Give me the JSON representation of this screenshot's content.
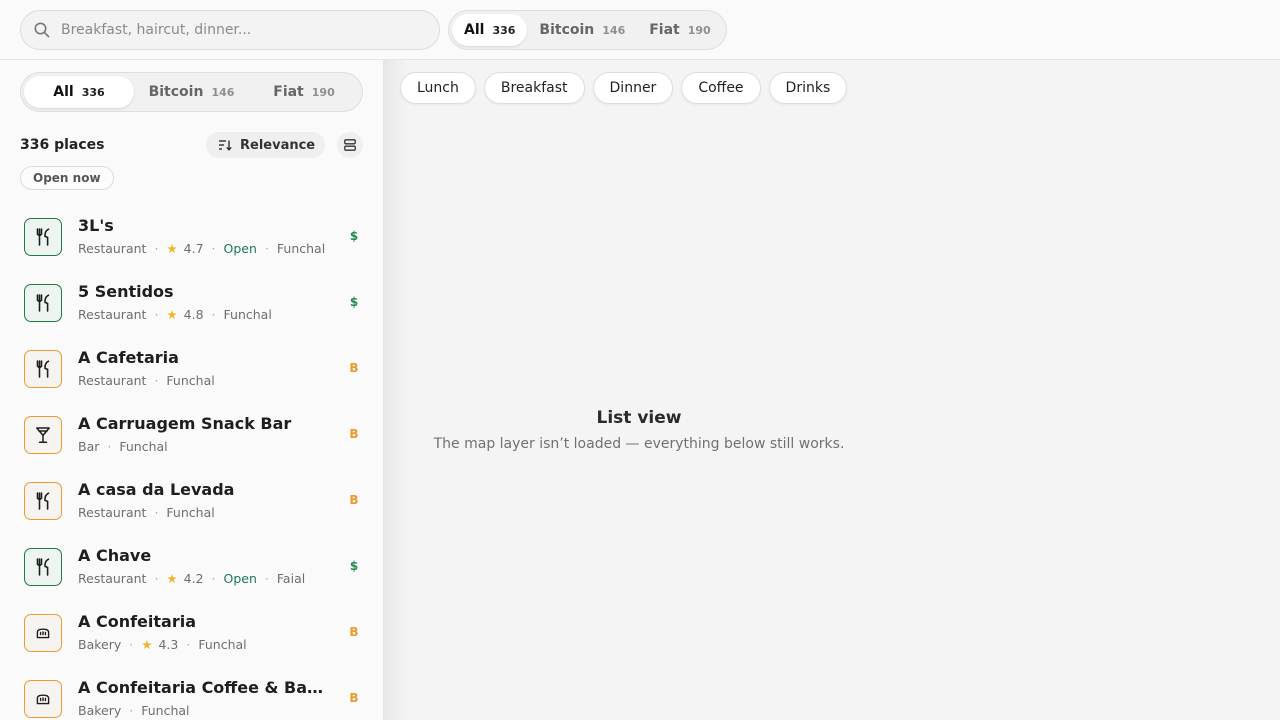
{
  "search": {
    "placeholder": "Breakfast, haircut, dinner..."
  },
  "payment_filter": [
    {
      "label": "All",
      "count": "336",
      "active": true
    },
    {
      "label": "Bitcoin",
      "count": "146",
      "active": false
    },
    {
      "label": "Fiat",
      "count": "190",
      "active": false
    }
  ],
  "sidebar": {
    "count_label": "336 places",
    "sort_label": "Relevance",
    "open_now_label": "Open now",
    "places": [
      {
        "name": "3L's",
        "category": "Restaurant",
        "rating": "4.7",
        "status": "Open",
        "town": "Funchal",
        "pay": "$",
        "icon": "fork-knife-icon"
      },
      {
        "name": "5 Sentidos",
        "category": "Restaurant",
        "rating": "4.8",
        "status": "",
        "town": "Funchal",
        "pay": "$",
        "icon": "fork-knife-icon"
      },
      {
        "name": "A Cafetaria",
        "category": "Restaurant",
        "rating": "",
        "status": "",
        "town": "Funchal",
        "pay": "B",
        "icon": "fork-knife-icon"
      },
      {
        "name": "A Carruagem Snack Bar",
        "category": "Bar",
        "rating": "",
        "status": "",
        "town": "Funchal",
        "pay": "B",
        "icon": "cocktail-icon"
      },
      {
        "name": "A casa da Levada",
        "category": "Restaurant",
        "rating": "",
        "status": "",
        "town": "Funchal",
        "pay": "B",
        "icon": "fork-knife-icon"
      },
      {
        "name": "A Chave",
        "category": "Restaurant",
        "rating": "4.2",
        "status": "Open",
        "town": "Faial",
        "pay": "$",
        "icon": "fork-knife-icon"
      },
      {
        "name": "A Confeitaria",
        "category": "Bakery",
        "rating": "4.3",
        "status": "",
        "town": "Funchal",
        "pay": "B",
        "icon": "bread-icon"
      },
      {
        "name": "A Confeitaria Coffee & Ba…",
        "category": "Bakery",
        "rating": "",
        "status": "",
        "town": "Funchal",
        "pay": "B",
        "icon": "bread-icon"
      }
    ]
  },
  "main": {
    "chips": [
      "Lunch",
      "Breakfast",
      "Dinner",
      "Coffee",
      "Drinks"
    ],
    "empty_title": "List view",
    "empty_subtitle": "The map layer isn’t loaded — everything below still works."
  },
  "colors": {
    "fiat": "#1f8a4c",
    "bitcoin": "#ec9a2b",
    "open": "#1b7a5a",
    "star": "#f0b429"
  }
}
